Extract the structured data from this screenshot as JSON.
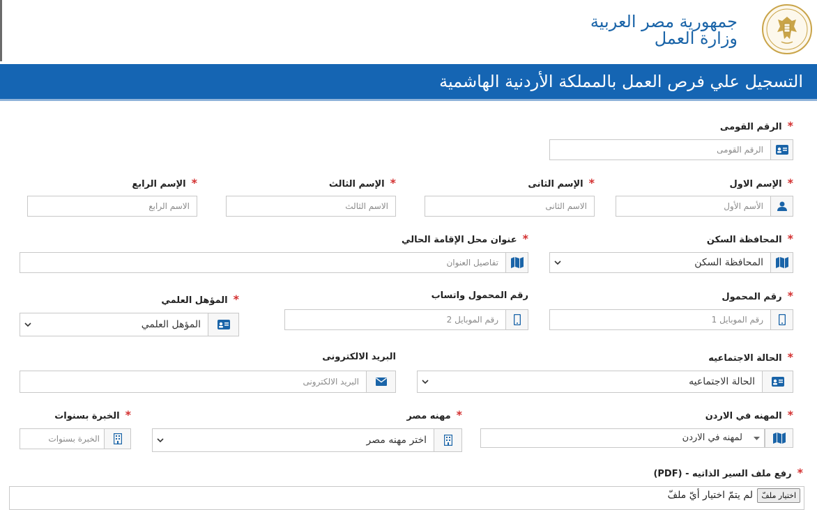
{
  "header": {
    "line1": "جمهورية مصر العربية",
    "line2": "وزارة العمل",
    "seal_top_text": "وزارة العمل",
    "seal_bottom_text": "Ministry of Labour"
  },
  "banner": {
    "title": "التسجيل علي فرص العمل بالمملكة الأردنية الهاشمية"
  },
  "form": {
    "national_id": {
      "label": "الرقم القومى",
      "placeholder": "الرقم القومى"
    },
    "first_name": {
      "label": "الإسم الاول",
      "placeholder": "الأسم الأول"
    },
    "second_name": {
      "label": "الإسم الثانى",
      "placeholder": "الاسم الثانى"
    },
    "third_name": {
      "label": "الإسم الثالث",
      "placeholder": "الاسم الثالث"
    },
    "fourth_name": {
      "label": "الإسم الرابع",
      "placeholder": "الاسم الرابع"
    },
    "governorate": {
      "label": "المحافظة السكن",
      "value": "المحافظة السكن"
    },
    "address": {
      "label": "عنوان محل الإقامة الحالي",
      "placeholder": "تفاصيل العنوان"
    },
    "mobile": {
      "label": "رقم المحمول",
      "placeholder": "رقم الموبايل 1"
    },
    "whatsapp": {
      "label": "رقم المحمول واتساب",
      "placeholder": "رقم الموبايل 2"
    },
    "qualification": {
      "label": "المؤهل العلمي",
      "value": "المؤهل العلمي"
    },
    "marital_status": {
      "label": "الحالة الاجتماعيه",
      "value": "الحالة الاجتماعيه"
    },
    "email": {
      "label": "البريد الالكترونى",
      "placeholder": "البريد الالكترونى"
    },
    "jordan_job": {
      "label": "المهنه في الاردن",
      "value": "لمهنه في الاردن"
    },
    "egypt_job": {
      "label": "مهنه مصر",
      "value": "اختر مهنه مصر"
    },
    "experience": {
      "label": "الخبرة بسنوات",
      "placeholder": "الخبرة بسنوات"
    },
    "cv_upload": {
      "label": "رفع ملف السير الذاتيه - (PDF)",
      "button": "اختيار ملفّ",
      "status": "لم يتمّ اختيار أيّ ملفّ"
    }
  },
  "colors": {
    "brand_blue": "#1565b3",
    "required_star": "#d32f2f",
    "icon_blue": "#1a64a8"
  }
}
